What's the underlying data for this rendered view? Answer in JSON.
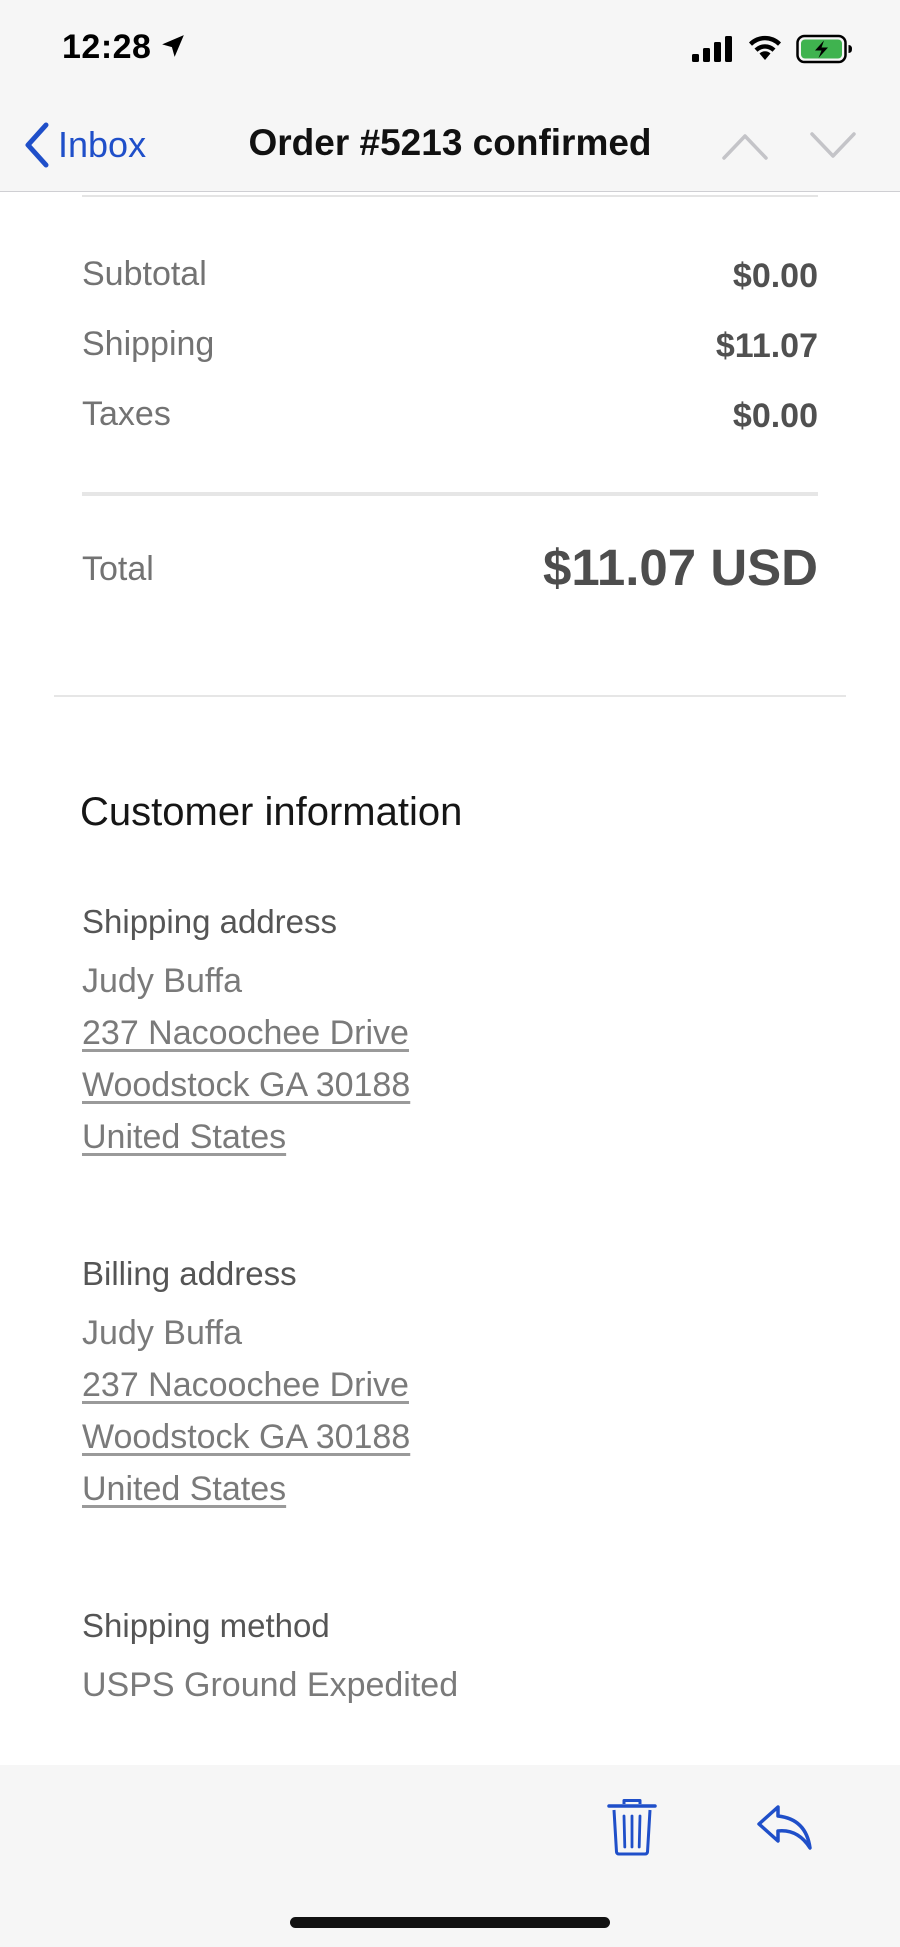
{
  "status_bar": {
    "time": "12:28",
    "icons": [
      "location-arrow-icon",
      "cellular-signal-icon",
      "wifi-icon",
      "battery-charging-icon"
    ],
    "battery_color": "#3fb34f"
  },
  "nav": {
    "back_label": "Inbox",
    "title": "Order #5213 confirmed",
    "accent_color": "#1f4fc9",
    "icons": [
      "chevron-left-icon",
      "chevron-up-icon",
      "chevron-down-icon"
    ]
  },
  "summary": {
    "rows": [
      {
        "label": "Subtotal",
        "value": "$0.00"
      },
      {
        "label": "Shipping",
        "value": "$11.07"
      },
      {
        "label": "Taxes",
        "value": "$0.00"
      }
    ],
    "total_label": "Total",
    "total_value": "$11.07 USD"
  },
  "customer_info": {
    "title": "Customer information",
    "shipping_address": {
      "heading": "Shipping address",
      "name": "Judy Buffa",
      "street": "237 Nacoochee Drive",
      "city_line": "Woodstock GA 30188",
      "country": "United States"
    },
    "billing_address": {
      "heading": "Billing address",
      "name": "Judy Buffa",
      "street": "237 Nacoochee Drive",
      "city_line": "Woodstock GA 30188",
      "country": "United States"
    },
    "shipping_method": {
      "heading": "Shipping method",
      "value": "USPS Ground Expedited"
    }
  },
  "toolbar": {
    "icons": [
      "trash-icon",
      "reply-icon"
    ]
  }
}
